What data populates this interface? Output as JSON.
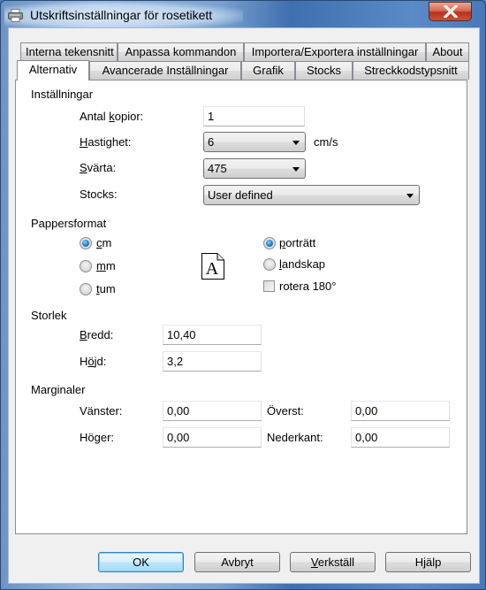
{
  "window": {
    "title": "Utskriftsinställningar för rosetikett",
    "icon": "printer-icon",
    "close_icon": "close-icon"
  },
  "tabs": {
    "row_back": [
      {
        "label": "Interna tekensnitt"
      },
      {
        "label": "Anpassa kommandon"
      },
      {
        "label": "Importera/Exportera inställningar"
      },
      {
        "label": "About"
      }
    ],
    "row_front": [
      {
        "label": "Alternativ",
        "active": true
      },
      {
        "label": "Avancerade Inställningar"
      },
      {
        "label": "Grafik"
      },
      {
        "label": "Stocks"
      },
      {
        "label": "Streckkodstypsnitt"
      }
    ]
  },
  "settings": {
    "section_label": "Inställningar",
    "copies": {
      "label_pre": "Antal ",
      "label_accel": "k",
      "label_post": "opior:",
      "value": "1"
    },
    "speed": {
      "label_accel": "H",
      "label_post": "astighet:",
      "value": "6",
      "unit": "cm/s"
    },
    "darkness": {
      "label_accel": "S",
      "label_post": "värta:",
      "value": "475"
    },
    "stocks": {
      "label": "Stocks:",
      "value": "User defined"
    }
  },
  "paper_format": {
    "section_label": "Pappersformat",
    "units": [
      {
        "accel": "c",
        "rest": "m",
        "checked": true
      },
      {
        "accel": "m",
        "rest": "m",
        "checked": false
      },
      {
        "accel": "t",
        "rest": "um",
        "checked": false
      }
    ],
    "orientation": [
      {
        "accel": "p",
        "rest": "orträtt",
        "checked": true
      },
      {
        "accel": "l",
        "rest": "andskap",
        "checked": false
      }
    ],
    "rotate": {
      "label": "rotera 180°",
      "checked": false
    },
    "preview_icon": "page-letter-a-icon",
    "preview_glyph": "A"
  },
  "size": {
    "section_label": "Storlek",
    "width": {
      "label_accel": "B",
      "label_post": "redd:",
      "value": "10,40"
    },
    "height": {
      "label_pre": "H",
      "label_accel": "ö",
      "label_post": "jd:",
      "value": "3,2"
    }
  },
  "margins": {
    "section_label": "Marginaler",
    "left": {
      "label": "Vänster:",
      "value": "0,00"
    },
    "top": {
      "label": "Överst:",
      "value": "0,00"
    },
    "right": {
      "label": "Höger:",
      "value": "0,00"
    },
    "bottom": {
      "label": "Nederkant:",
      "value": "0,00"
    }
  },
  "buttons": {
    "ok": "OK",
    "cancel": "Avbryt",
    "apply_accel": "V",
    "apply_rest": "erkställ",
    "help": "Hjälp"
  }
}
